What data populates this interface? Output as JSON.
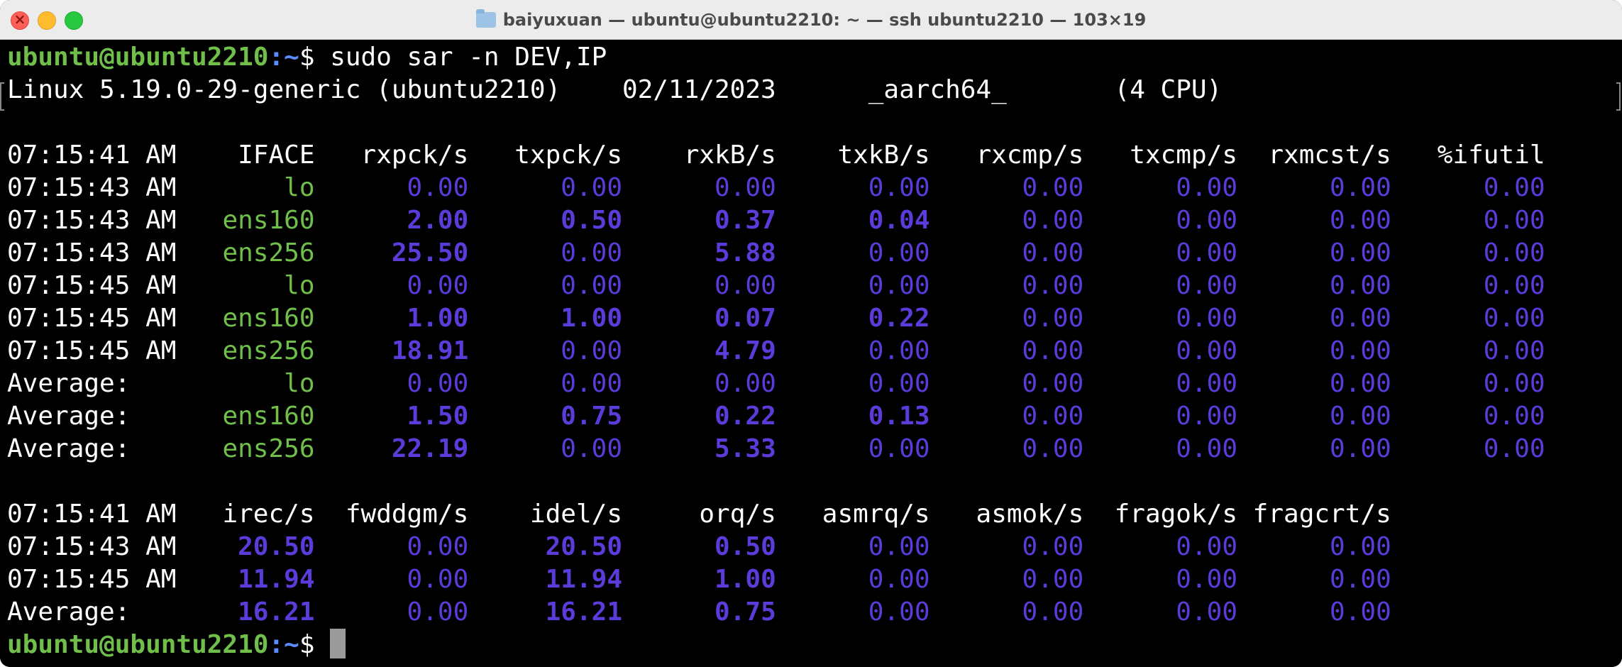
{
  "window": {
    "title": "baiyuxuan — ubuntu@ubuntu2210: ~ — ssh ubuntu2210 — 103×19",
    "folder_icon": "folder-icon"
  },
  "colors": {
    "user": "#6fbf4a",
    "iface": "#6fbf4a",
    "values": "#5b3bd9",
    "text": "#ffffff",
    "background": "#000000"
  },
  "terminal": {
    "prompt_user": "ubuntu@ubuntu2210",
    "prompt_path": ":~",
    "prompt_suffix": "$ ",
    "command": "sudo sar -n DEV,IP",
    "sysinfo": "Linux 5.19.0-29-generic (ubuntu2210)    02/11/2023      _aarch64_       (4 CPU)",
    "dev_header": [
      "07:15:41 AM",
      "IFACE",
      "rxpck/s",
      "txpck/s",
      "rxkB/s",
      "txkB/s",
      "rxcmp/s",
      "txcmp/s",
      "rxmcst/s",
      "%ifutil"
    ],
    "dev_rows": [
      {
        "time": "07:15:43 AM",
        "iface": "lo",
        "vals": [
          "0.00",
          "0.00",
          "0.00",
          "0.00",
          "0.00",
          "0.00",
          "0.00",
          "0.00"
        ]
      },
      {
        "time": "07:15:43 AM",
        "iface": "ens160",
        "vals": [
          "2.00",
          "0.50",
          "0.37",
          "0.04",
          "0.00",
          "0.00",
          "0.00",
          "0.00"
        ]
      },
      {
        "time": "07:15:43 AM",
        "iface": "ens256",
        "vals": [
          "25.50",
          "0.00",
          "5.88",
          "0.00",
          "0.00",
          "0.00",
          "0.00",
          "0.00"
        ]
      },
      {
        "time": "07:15:45 AM",
        "iface": "lo",
        "vals": [
          "0.00",
          "0.00",
          "0.00",
          "0.00",
          "0.00",
          "0.00",
          "0.00",
          "0.00"
        ]
      },
      {
        "time": "07:15:45 AM",
        "iface": "ens160",
        "vals": [
          "1.00",
          "1.00",
          "0.07",
          "0.22",
          "0.00",
          "0.00",
          "0.00",
          "0.00"
        ]
      },
      {
        "time": "07:15:45 AM",
        "iface": "ens256",
        "vals": [
          "18.91",
          "0.00",
          "4.79",
          "0.00",
          "0.00",
          "0.00",
          "0.00",
          "0.00"
        ]
      },
      {
        "time": "Average:",
        "iface": "lo",
        "vals": [
          "0.00",
          "0.00",
          "0.00",
          "0.00",
          "0.00",
          "0.00",
          "0.00",
          "0.00"
        ]
      },
      {
        "time": "Average:",
        "iface": "ens160",
        "vals": [
          "1.50",
          "0.75",
          "0.22",
          "0.13",
          "0.00",
          "0.00",
          "0.00",
          "0.00"
        ]
      },
      {
        "time": "Average:",
        "iface": "ens256",
        "vals": [
          "22.19",
          "0.00",
          "5.33",
          "0.00",
          "0.00",
          "0.00",
          "0.00",
          "0.00"
        ]
      }
    ],
    "ip_header": [
      "07:15:41 AM",
      "irec/s",
      "fwddgm/s",
      "idel/s",
      "orq/s",
      "asmrq/s",
      "asmok/s",
      "fragok/s",
      "fragcrt/s"
    ],
    "ip_rows": [
      {
        "time": "07:15:43 AM",
        "vals": [
          "20.50",
          "0.00",
          "20.50",
          "0.50",
          "0.00",
          "0.00",
          "0.00",
          "0.00"
        ]
      },
      {
        "time": "07:15:45 AM",
        "vals": [
          "11.94",
          "0.00",
          "11.94",
          "1.00",
          "0.00",
          "0.00",
          "0.00",
          "0.00"
        ]
      },
      {
        "time": "Average:",
        "vals": [
          "16.21",
          "0.00",
          "16.21",
          "0.75",
          "0.00",
          "0.00",
          "0.00",
          "0.00"
        ]
      }
    ]
  }
}
